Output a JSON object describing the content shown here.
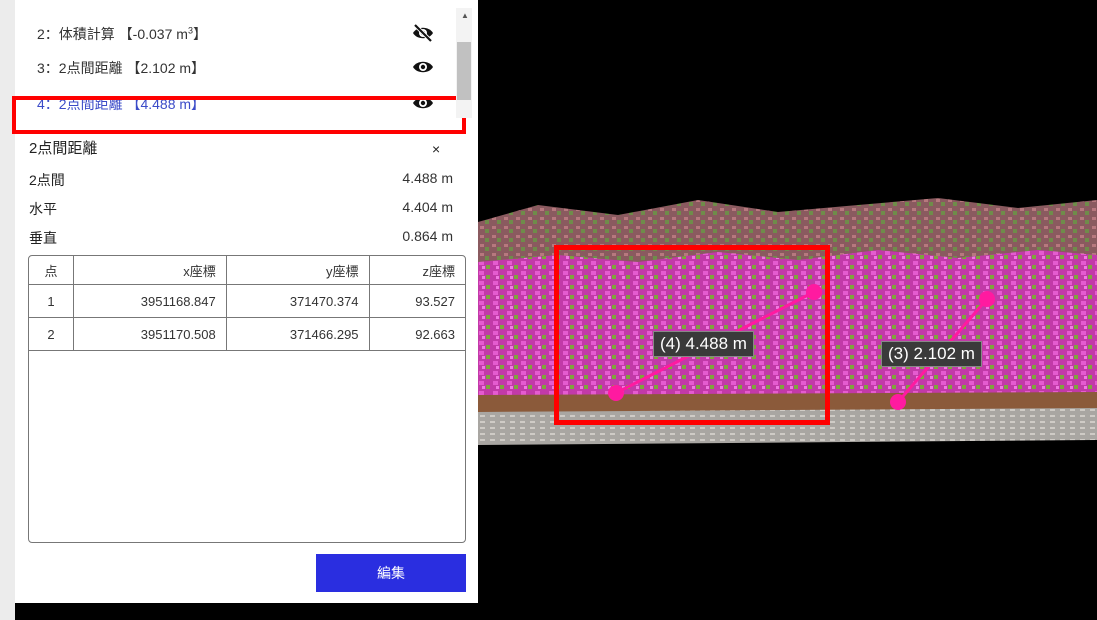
{
  "layers": [
    {
      "index_label": "2：体積計算",
      "value": "【-0.037 m",
      "sup": "3",
      "suffix": "】",
      "eye": "eye-slash-icon",
      "active": false
    },
    {
      "index_label": "3：2点間距離",
      "value": "【2.102 m】",
      "eye": "eye-icon",
      "active": false
    },
    {
      "index_label": "4：2点間距離",
      "value": "【4.488 m】",
      "eye": "eye-icon",
      "active": true
    }
  ],
  "detail": {
    "title": "2点間距離",
    "close": "×",
    "rows": [
      {
        "label": "2点間",
        "value": "4.488 m"
      },
      {
        "label": "水平",
        "value": "4.404 m"
      },
      {
        "label": "垂直",
        "value": "0.864 m"
      }
    ],
    "table": {
      "headers": [
        "点",
        "x座標",
        "y座標",
        "z座標"
      ],
      "rows": [
        [
          "1",
          "3951168.847",
          "371470.374",
          "93.527"
        ],
        [
          "2",
          "3951170.508",
          "371466.295",
          "92.663"
        ]
      ]
    },
    "edit_label": "編集"
  },
  "viewer": {
    "measure_4": "(4) 4.488 m",
    "measure_3": "(3) 2.102 m",
    "measure_color": "#ff1aa0"
  },
  "colors": {
    "accent": "#2a2ee0",
    "highlight": "#ff0000",
    "active_text": "#3b4bc8"
  }
}
